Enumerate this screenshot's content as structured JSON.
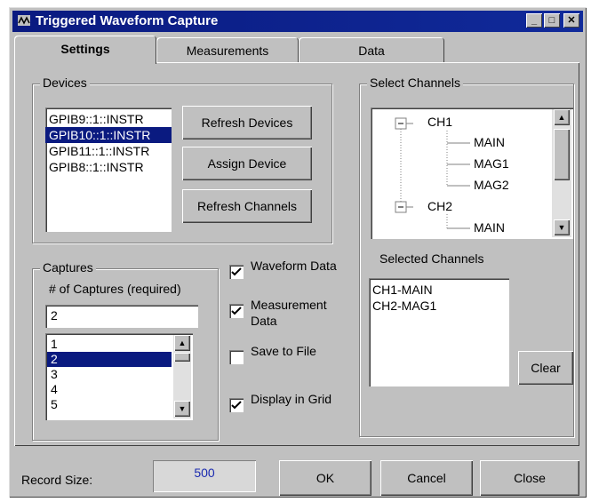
{
  "window": {
    "title": "Triggered Waveform Capture"
  },
  "tabs": [
    {
      "label": "Settings"
    },
    {
      "label": "Measurements"
    },
    {
      "label": "Data"
    }
  ],
  "devices": {
    "label": "Devices",
    "items": [
      "GPIB9::1::INSTR",
      "GPIB10::1::INSTR",
      "GPIB11::1::INSTR",
      "GPIB8::1::INSTR"
    ],
    "selected": "GPIB10::1::INSTR",
    "refresh_devices_label": "Refresh Devices",
    "assign_device_label": "Assign Device",
    "refresh_channels_label": "Refresh Channels"
  },
  "captures": {
    "label": "Captures",
    "count_label": "# of Captures (required)",
    "count_value": "2",
    "items": [
      "1",
      "2",
      "3",
      "4",
      "5"
    ],
    "selected": "2"
  },
  "options": [
    {
      "label": "Waveform Data",
      "checked": true
    },
    {
      "label": "Measurement Data",
      "checked": true
    },
    {
      "label": "Save to File",
      "checked": false
    },
    {
      "label": "Display in Grid",
      "checked": true
    }
  ],
  "channels": {
    "label": "Select Channels",
    "tree": [
      "CH1",
      "MAIN",
      "MAG1",
      "MAG2",
      "CH2",
      "MAIN"
    ],
    "selected_label": "Selected Channels",
    "selected_items": [
      "CH1-MAIN",
      "CH2-MAG1"
    ],
    "clear_label": "Clear"
  },
  "footer": {
    "record_size_label": "Record Size:",
    "record_size_value": "500",
    "ok_label": "OK",
    "cancel_label": "Cancel",
    "close_label": "Close"
  }
}
